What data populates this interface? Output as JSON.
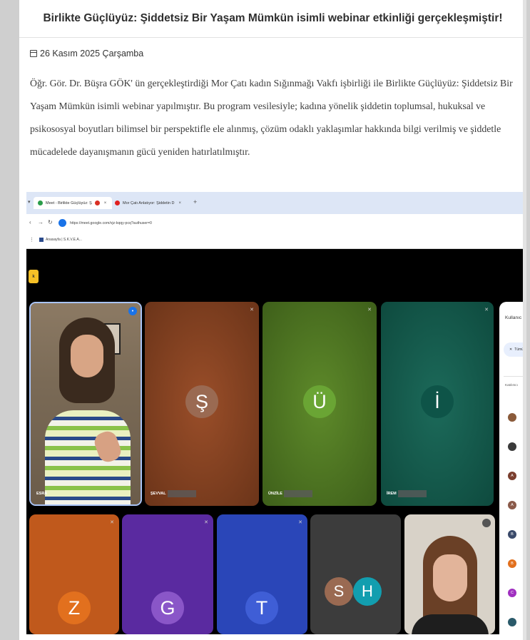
{
  "article": {
    "title": "Birlikte Güçlüyüz: Şiddetsiz Bir Yaşam Mümkün isimli webinar etkinliği gerçekleşmiştir!",
    "date": "26 Kasım 2025 Çarşamba",
    "body": "Öğr. Gör. Dr. Büşra GÖK' ün gerçekleştirdiği Mor Çatı kadın Sığınmağı Vakfı işbirliği ile Birlikte Güçlüyüz: Şiddetsiz Bir Yaşam Mümkün isimli webinar yapılmıştır. Bu program vesilesiyle; kadına yönelik şiddetin toplumsal, hukuksal ve psikososyal boyutları bilimsel bir perspektifle ele alınmış, çözüm odaklı yaklaşımlar hakkında bilgi verilmiş ve şiddetle mücadelede dayanışmanın gücü yeniden hatırlatılmıştır."
  },
  "screenshot": {
    "tabs": [
      {
        "label": "Meet - Birlikte Güçlüyüz: Ş",
        "close": "×"
      },
      {
        "label": "Mor Çatı Anlatıyor: Şiddetin D",
        "close": "×"
      }
    ],
    "new_tab": "+",
    "url": "https://meet.google.com/vjz-kqqy-pcq?authuser=0",
    "bookmark": "Anasayfa | S.K.V.E.A...",
    "meet_badge": "k",
    "participants": [
      {
        "initial": "",
        "name": "ESRA"
      },
      {
        "initial": "Ş",
        "name": "ŞEVVAL",
        "avatar_color": "#9a6a52"
      },
      {
        "initial": "Ü",
        "name": "ÜNZİLE",
        "avatar_color": "#6aa534"
      },
      {
        "initial": "İ",
        "name": "İREM",
        "avatar_color": "#0e5448"
      },
      {
        "initial": "Z",
        "avatar_color": "#e2701e"
      },
      {
        "initial": "G",
        "avatar_color": "#8a56c8"
      },
      {
        "initial": "T",
        "avatar_color": "#3f5ed6"
      },
      {
        "initial": "S",
        "avatar_color": "#9a6a52"
      },
      {
        "initial": "H",
        "avatar_color": "#129eaf"
      }
    ],
    "side_panel": {
      "title": "Kullanıc",
      "chip": "Tümü",
      "section": "Katılımcı",
      "avatars": [
        {
          "initial": "",
          "color": "#8a5a3a"
        },
        {
          "initial": "",
          "color": "#3a3a3a"
        },
        {
          "initial": "A",
          "color": "#7a3e2e"
        },
        {
          "initial": "A",
          "color": "#8a5a4a"
        },
        {
          "initial": "B",
          "color": "#3a4a6a"
        },
        {
          "initial": "B",
          "color": "#e2701e"
        },
        {
          "initial": "C",
          "color": "#a030c0"
        },
        {
          "initial": "",
          "color": "#2a5a6a"
        }
      ]
    }
  }
}
